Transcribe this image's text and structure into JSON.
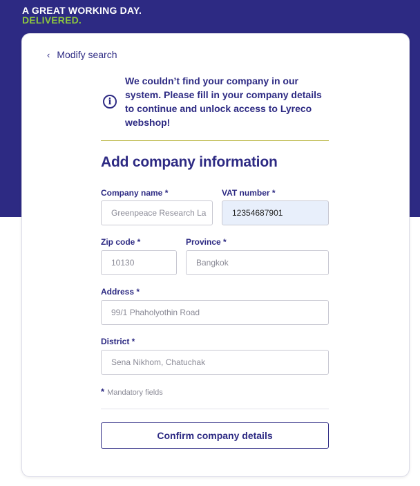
{
  "header": {
    "tagline_line1": "A GREAT WORKING DAY.",
    "tagline_line2": "DELIVERED."
  },
  "nav": {
    "back_label": "Modify search"
  },
  "notice": {
    "text": "We couldn’t find your company in our system. Please fill in your company details to continue and unlock access to Lyreco webshop!"
  },
  "form": {
    "title": "Add company information",
    "company_name": {
      "label": "Company name *",
      "value": "Greenpeace Research La"
    },
    "vat_number": {
      "label": "VAT number *",
      "value": "12354687901"
    },
    "zip_code": {
      "label": "Zip code *",
      "value": "10130"
    },
    "province": {
      "label": "Province *",
      "value": "Bangkok"
    },
    "address": {
      "label": "Address *",
      "value": "99/1 Phaholyothin Road"
    },
    "district": {
      "label": "District *",
      "value": "Sena Nikhom, Chatuchak"
    },
    "mandatory_star": "*",
    "mandatory_note": "Mandatory fields",
    "confirm_label": "Confirm company details"
  },
  "colors": {
    "brand_navy": "#2d2a83",
    "brand_green": "#8cc63f",
    "accent_divider": "#b7b33a"
  }
}
